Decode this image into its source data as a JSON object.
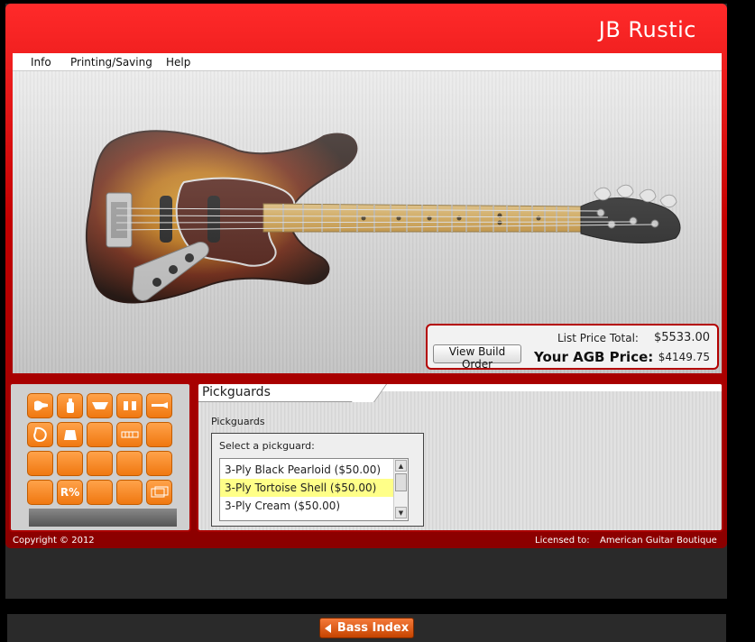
{
  "window": {
    "title": "JB Rustic"
  },
  "menu": [
    {
      "label": "Info"
    },
    {
      "label": "Printing/Saving"
    },
    {
      "label": "Help"
    }
  ],
  "price": {
    "view_build_label": "View Build Order",
    "list_label": "List Price Total:",
    "list_value": "$5533.00",
    "agb_label": "Your AGB Price:",
    "agb_value": "$4149.75"
  },
  "tools": {
    "reset_label": "R%"
  },
  "panel": {
    "tab_label": "Pickguards",
    "section_label": "Pickguards",
    "selector_label": "Select a pickguard:",
    "options": [
      {
        "label": "3-Ply Black Pearloid ($50.00)"
      },
      {
        "label": "3-Ply Tortoise Shell ($50.00)"
      },
      {
        "label": "3-Ply Cream ($50.00)"
      }
    ],
    "selected_index": 1
  },
  "footer": {
    "copyright": "Copyright © 2012",
    "licensed_label": "Licensed to:",
    "licensed_value": "American Guitar Boutique"
  },
  "nav": {
    "bass_index_label": "Bass Index"
  },
  "colors": {
    "accent_red": "#c40000",
    "tool_orange": "#f07810",
    "highlight": "#ffff88"
  }
}
